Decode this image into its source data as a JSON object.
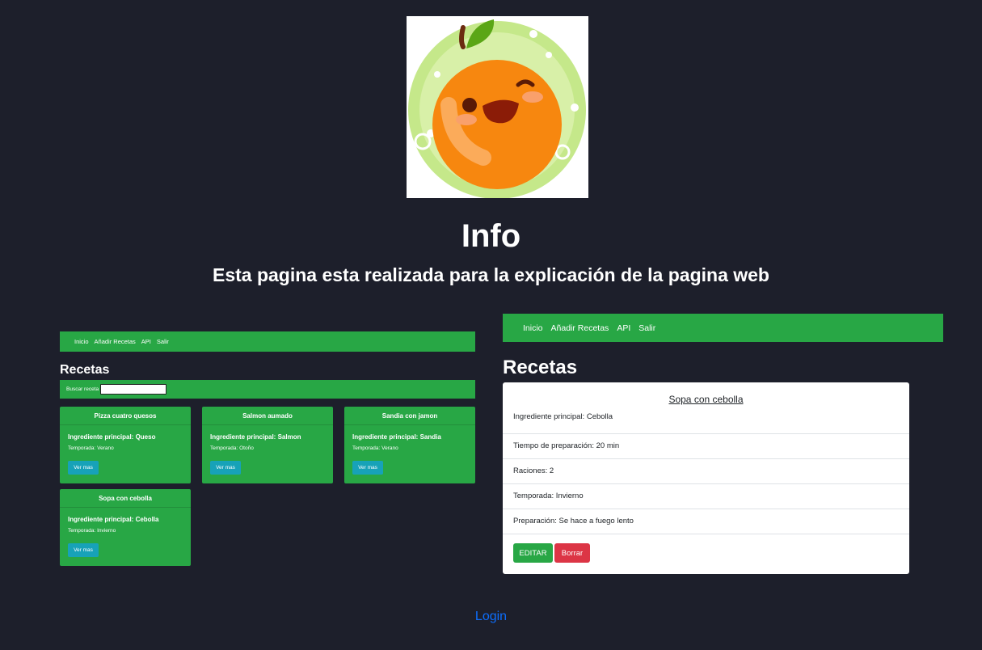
{
  "header": {
    "logo_icon": "smiling-orange-icon",
    "title": "Info",
    "subtitle": "Esta pagina esta realizada para la explicación de la pagina web"
  },
  "left_screenshot": {
    "nav": [
      "Inicio",
      "Añadir Recetas",
      "API",
      "Salir"
    ],
    "title": "Recetas",
    "search_label": "Buscar receta",
    "cards": [
      {
        "name": "Pizza cuatro quesos",
        "ingredient": "Ingrediente principal: Queso",
        "season": "Temporada: Verano",
        "button": "Ver mas"
      },
      {
        "name": "Salmon aumado",
        "ingredient": "Ingrediente principal: Salmon",
        "season": "Temporada: Otoño",
        "button": "Ver mas"
      },
      {
        "name": "Sandia con jamon",
        "ingredient": "Ingrediente principal: Sandia",
        "season": "Temporada: Verano",
        "button": "Ver mas"
      },
      {
        "name": "Sopa con cebolla",
        "ingredient": "Ingrediente principal: Cebolla",
        "season": "Temporada: Invierno",
        "button": "Ver mas"
      }
    ]
  },
  "right_screenshot": {
    "nav": [
      "Inicio",
      "Añadir Recetas",
      "API",
      "Salir"
    ],
    "title": "Recetas",
    "detail": {
      "name": "Sopa con cebolla",
      "ingredient": "Ingrediente principal: Cebolla",
      "prep_time": "Tiempo de preparación: 20 min",
      "servings": "Raciones: 2",
      "season": "Temporada: Invierno",
      "preparation": "Preparación: Se hace a fuego lento",
      "edit_button": "EDITAR",
      "delete_button": "Borrar"
    }
  },
  "footer": {
    "login_link": "Login"
  },
  "colors": {
    "background": "#1d1f2b",
    "green": "#28a745",
    "info_button": "#17a2b8",
    "danger": "#dc3545",
    "link": "#0d6efd"
  }
}
